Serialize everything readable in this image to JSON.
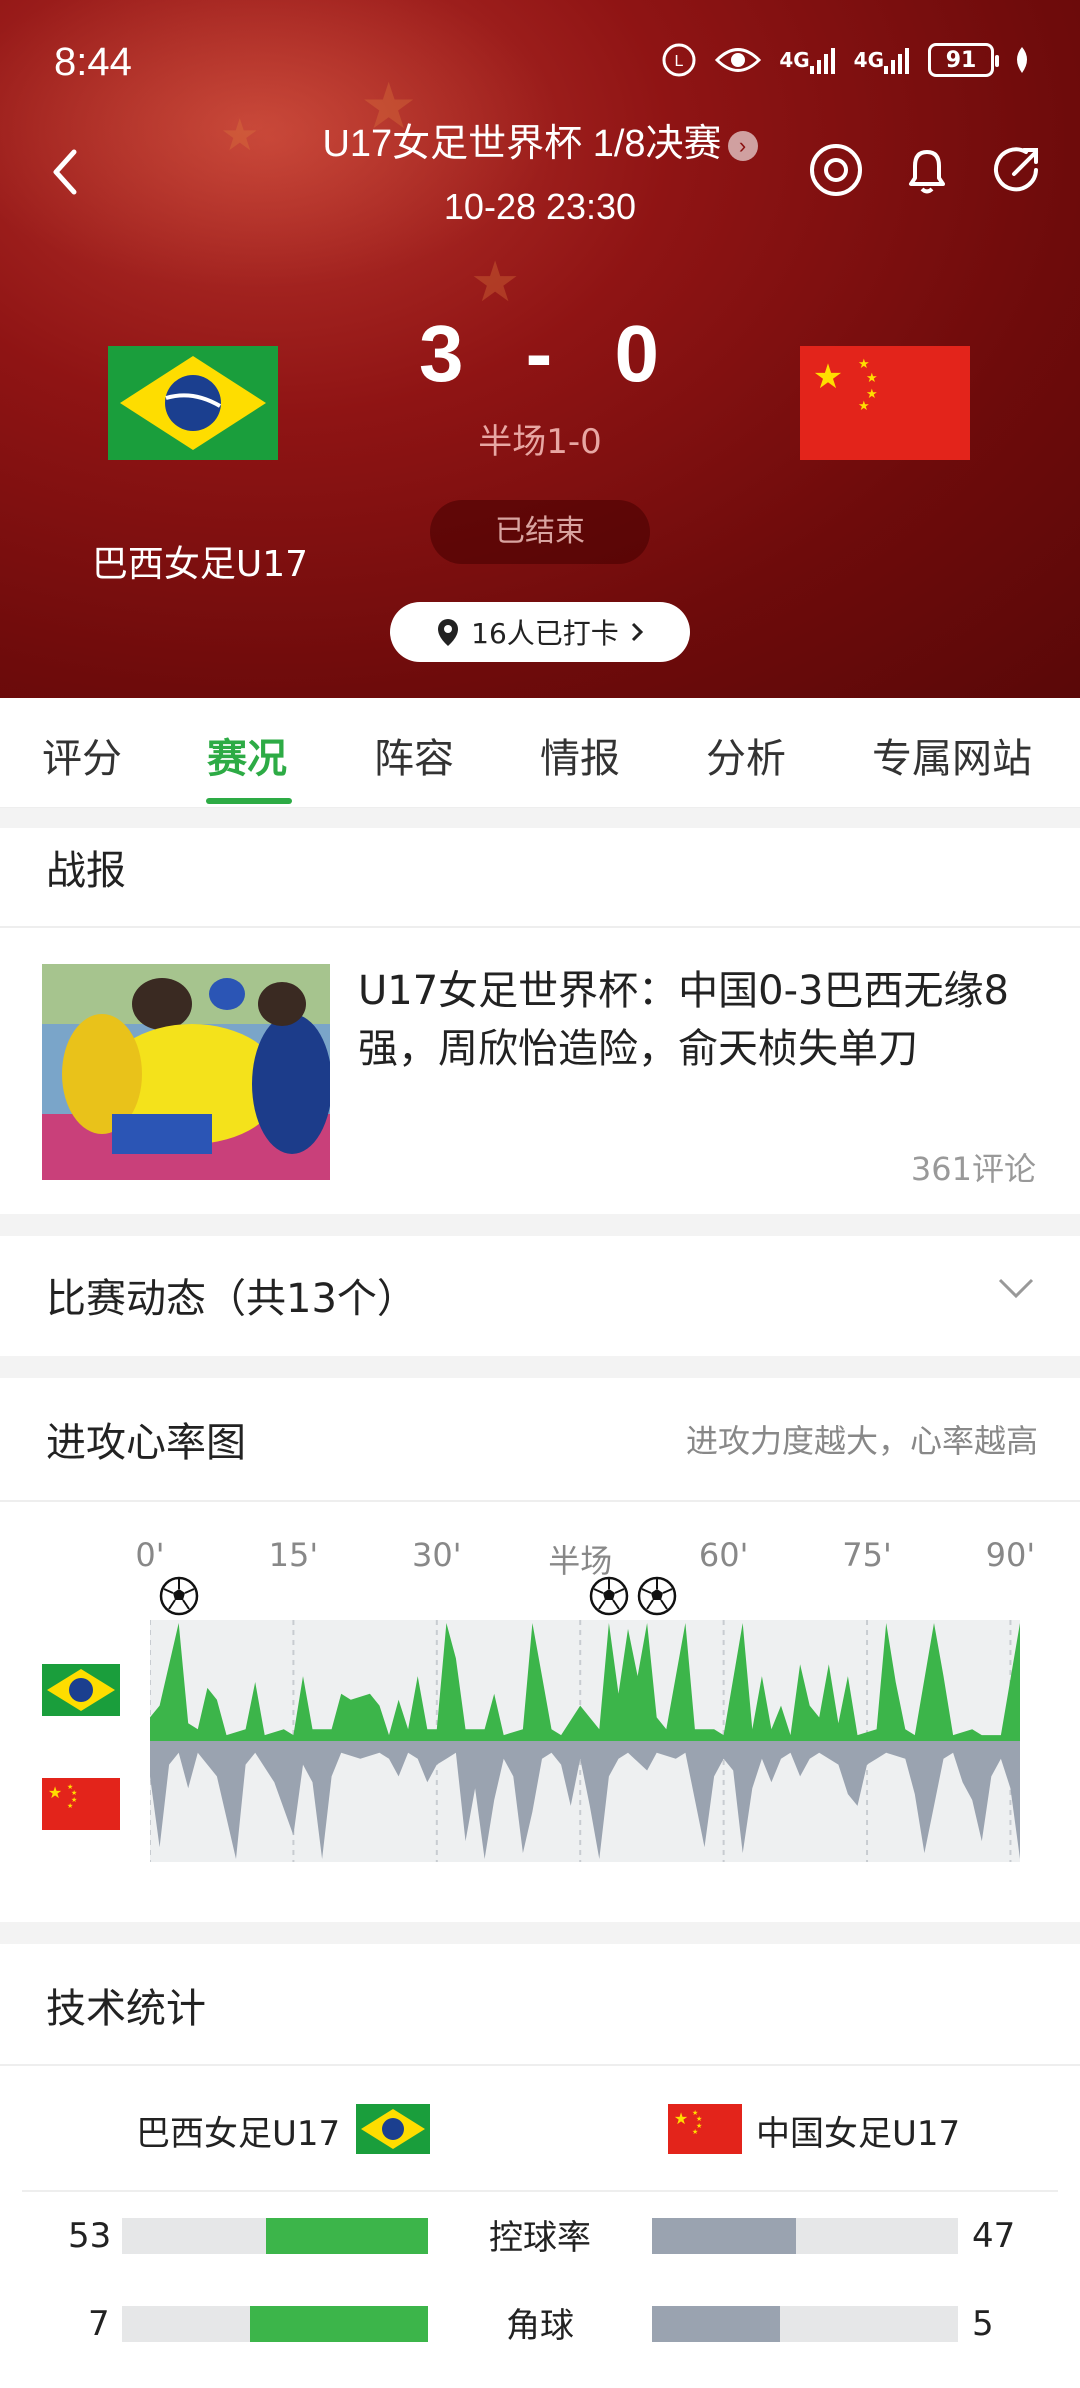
{
  "status_bar": {
    "time": "8:44",
    "battery": "91",
    "signal1": "4G",
    "signal2": "4G"
  },
  "header": {
    "title": "U17女足世界杯 1/8决赛",
    "datetime": "10-28 23:30",
    "score_home": "3",
    "score_sep": "-",
    "score_away": "0",
    "halftime": "半场1-0",
    "status": "已结束",
    "home_team": "巴西女足U17",
    "checkin": "16人已打卡"
  },
  "tabs": [
    "评分",
    "赛况",
    "阵容",
    "情报",
    "分析",
    "专属网站"
  ],
  "active_tab": 1,
  "report": {
    "section_title": "战报",
    "headline": "U17女足世界杯：中国0-3巴西无缘8强，周欣怡造险，俞天桢失单刀",
    "comments": "361评论"
  },
  "events": {
    "title": "比赛动态（共13个）"
  },
  "heart_chart": {
    "title": "进攻心率图",
    "hint": "进攻力度越大，心率越高"
  },
  "chart_data": {
    "type": "area",
    "x_ticks": [
      "0'",
      "15'",
      "30'",
      "半场",
      "60'",
      "75'",
      "90'"
    ],
    "x_tick_minutes": [
      0,
      15,
      30,
      45,
      60,
      75,
      90
    ],
    "goal_minutes": [
      3,
      48,
      53
    ],
    "ylim": [
      -1,
      1
    ],
    "series": [
      {
        "color": "#3cb54a",
        "points": [
          [
            0,
            0.2
          ],
          [
            1,
            0.3
          ],
          [
            3,
            1
          ],
          [
            4,
            0.15
          ],
          [
            5,
            0.1
          ],
          [
            6,
            0.45
          ],
          [
            7,
            0.35
          ],
          [
            8,
            0.05
          ],
          [
            10,
            0.1
          ],
          [
            11,
            0.5
          ],
          [
            12,
            0.05
          ],
          [
            14,
            0.1
          ],
          [
            15,
            0.05
          ],
          [
            16,
            0.55
          ],
          [
            17,
            0.1
          ],
          [
            19,
            0.1
          ],
          [
            20,
            0.4
          ],
          [
            21,
            0.35
          ],
          [
            23,
            0.4
          ],
          [
            24,
            0.3
          ],
          [
            25,
            0.05
          ],
          [
            26,
            0.35
          ],
          [
            27,
            0.1
          ],
          [
            28,
            0.55
          ],
          [
            29,
            0.1
          ],
          [
            30,
            0.1
          ],
          [
            31,
            1
          ],
          [
            32,
            0.7
          ],
          [
            33,
            0.1
          ],
          [
            35,
            0.1
          ],
          [
            36,
            0.4
          ],
          [
            37,
            0.05
          ],
          [
            39,
            0.1
          ],
          [
            40,
            1
          ],
          [
            41,
            0.55
          ],
          [
            42,
            0.1
          ],
          [
            43,
            0.05
          ],
          [
            45,
            0.3
          ],
          [
            47,
            0.1
          ],
          [
            48,
            1
          ],
          [
            49,
            0.4
          ],
          [
            50,
            0.95
          ],
          [
            51,
            0.55
          ],
          [
            52,
            1
          ],
          [
            53,
            0.2
          ],
          [
            54,
            0.1
          ],
          [
            56,
            1
          ],
          [
            57,
            0.1
          ],
          [
            59,
            0.1
          ],
          [
            60,
            0.05
          ],
          [
            62,
            1
          ],
          [
            63,
            0.1
          ],
          [
            64,
            0.55
          ],
          [
            65,
            0.1
          ],
          [
            66,
            0.3
          ],
          [
            67,
            0.05
          ],
          [
            68,
            0.65
          ],
          [
            69,
            0.3
          ],
          [
            70,
            0.2
          ],
          [
            71,
            0.65
          ],
          [
            72,
            0.15
          ],
          [
            73,
            0.55
          ],
          [
            74,
            0.05
          ],
          [
            76,
            0.1
          ],
          [
            77,
            1
          ],
          [
            78,
            0.5
          ],
          [
            79,
            0.1
          ],
          [
            80,
            0.05
          ],
          [
            82,
            1
          ],
          [
            83,
            0.55
          ],
          [
            84,
            0.05
          ],
          [
            86,
            0.1
          ],
          [
            87,
            0.05
          ],
          [
            89,
            0.05
          ],
          [
            91,
            1
          ]
        ]
      },
      {
        "color": "#9aa3b0",
        "points": [
          [
            0,
            -0.3
          ],
          [
            1,
            -0.9
          ],
          [
            2,
            -0.2
          ],
          [
            3,
            -0.1
          ],
          [
            4,
            -0.4
          ],
          [
            5,
            -0.1
          ],
          [
            7,
            -0.3
          ],
          [
            9,
            -1
          ],
          [
            10,
            -0.2
          ],
          [
            11,
            -0.1
          ],
          [
            13,
            -0.35
          ],
          [
            15,
            -0.8
          ],
          [
            16,
            -0.2
          ],
          [
            17,
            -0.35
          ],
          [
            18,
            -1
          ],
          [
            19,
            -0.3
          ],
          [
            20,
            -0.1
          ],
          [
            22,
            -0.15
          ],
          [
            24,
            -0.1
          ],
          [
            25,
            -0.15
          ],
          [
            26,
            -0.3
          ],
          [
            27,
            -0.1
          ],
          [
            28,
            -0.15
          ],
          [
            29,
            -0.35
          ],
          [
            30,
            -0.2
          ],
          [
            31,
            -0.15
          ],
          [
            32,
            -0.1
          ],
          [
            33,
            -0.85
          ],
          [
            34,
            -0.4
          ],
          [
            35,
            -1
          ],
          [
            36,
            -0.5
          ],
          [
            37,
            -0.15
          ],
          [
            38,
            -0.3
          ],
          [
            39,
            -0.95
          ],
          [
            40,
            -0.6
          ],
          [
            41,
            -0.15
          ],
          [
            42,
            -0.1
          ],
          [
            43,
            -0.2
          ],
          [
            44,
            -0.55
          ],
          [
            45,
            -0.15
          ],
          [
            46,
            -0.55
          ],
          [
            47,
            -1
          ],
          [
            48,
            -0.3
          ],
          [
            49,
            -0.15
          ],
          [
            50,
            -0.1
          ],
          [
            52,
            -0.25
          ],
          [
            53,
            -0.1
          ],
          [
            55,
            -0.15
          ],
          [
            56,
            -0.1
          ],
          [
            58,
            -0.9
          ],
          [
            59,
            -0.3
          ],
          [
            60,
            -0.15
          ],
          [
            61,
            -0.25
          ],
          [
            62,
            -0.95
          ],
          [
            63,
            -0.4
          ],
          [
            64,
            -0.15
          ],
          [
            65,
            -0.35
          ],
          [
            66,
            -0.15
          ],
          [
            67,
            -0.1
          ],
          [
            68,
            -0.3
          ],
          [
            69,
            -0.15
          ],
          [
            70,
            -0.1
          ],
          [
            72,
            -0.2
          ],
          [
            73,
            -0.45
          ],
          [
            74,
            -0.55
          ],
          [
            75,
            -0.2
          ],
          [
            76,
            -0.15
          ],
          [
            77,
            -0.1
          ],
          [
            79,
            -0.15
          ],
          [
            80,
            -0.45
          ],
          [
            81,
            -0.95
          ],
          [
            82,
            -0.55
          ],
          [
            83,
            -0.15
          ],
          [
            84,
            -0.1
          ],
          [
            85,
            -0.35
          ],
          [
            86,
            -0.5
          ],
          [
            87,
            -0.85
          ],
          [
            88,
            -0.3
          ],
          [
            89,
            -0.15
          ],
          [
            90,
            -0.4
          ],
          [
            91,
            -1
          ]
        ]
      }
    ]
  },
  "tech_stats": {
    "title": "技术统计",
    "home_team": "巴西女足U17",
    "away_team": "中国女足U17",
    "home_color": "#3cb54a",
    "away_color": "#9aa3b0",
    "rows": [
      {
        "name": "控球率",
        "home": "53",
        "away": "47",
        "home_val": 53,
        "away_val": 47
      },
      {
        "name": "角球",
        "home": "7",
        "away": "5",
        "home_val": 7,
        "away_val": 5
      }
    ]
  }
}
